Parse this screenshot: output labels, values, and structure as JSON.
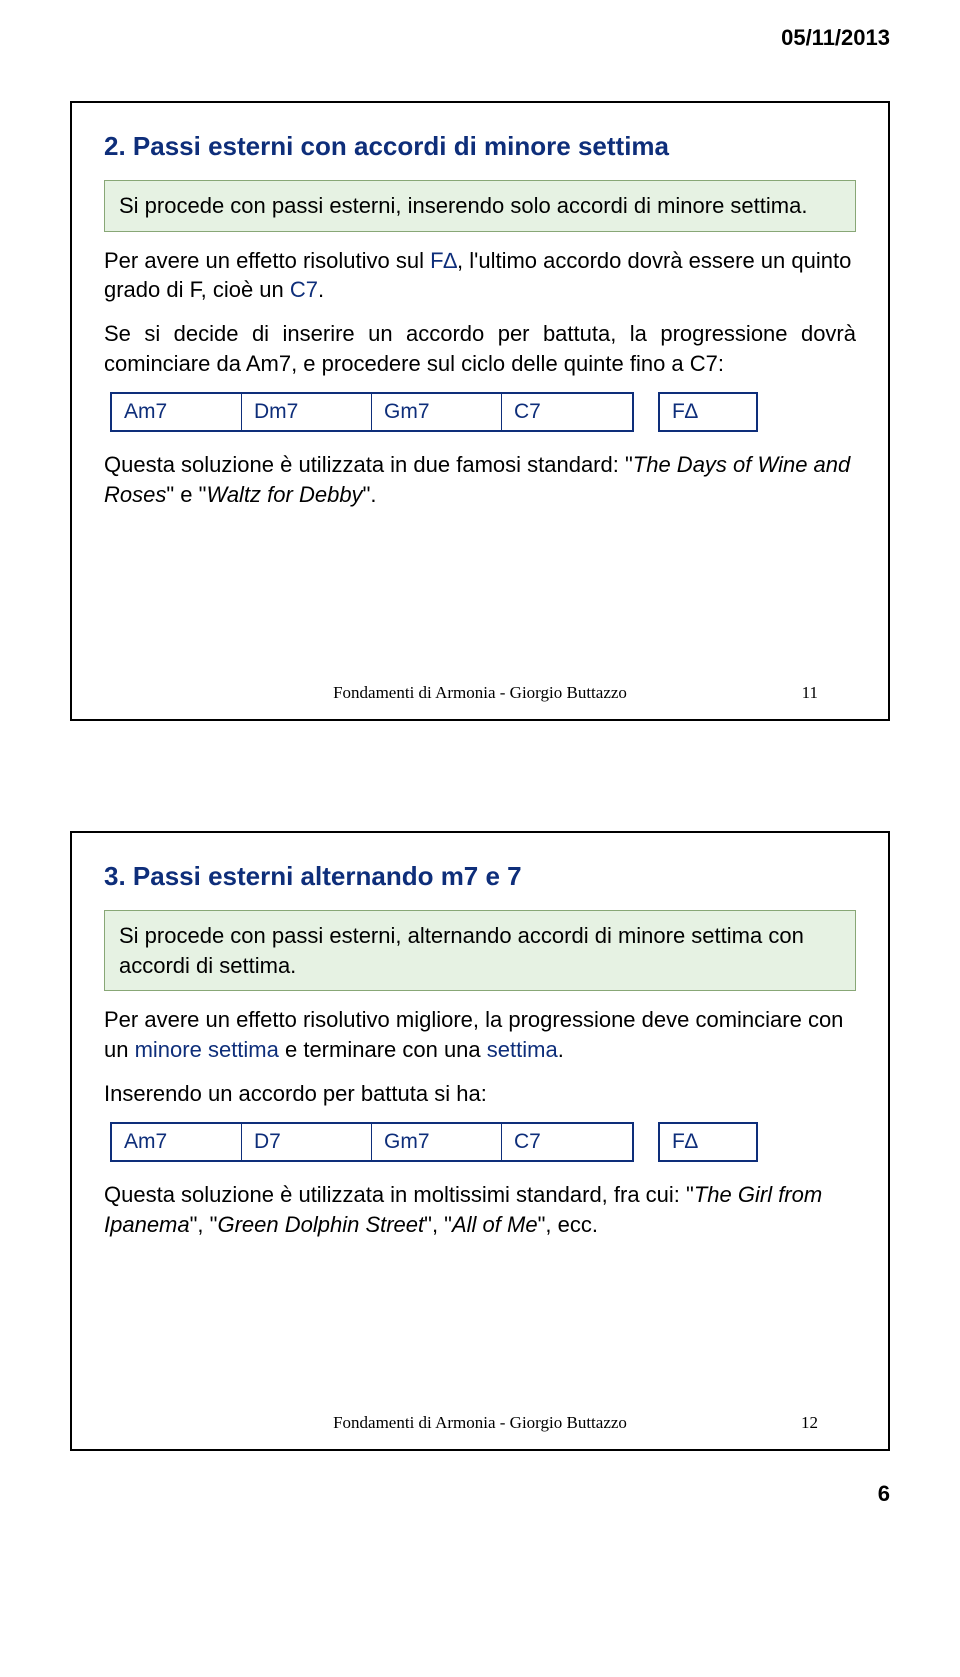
{
  "date": "05/11/2013",
  "page_number": "6",
  "slide1": {
    "title": "2. Passi esterni con accordi di minore settima",
    "callout": "Si procede con passi esterni, inserendo solo accordi di minore settima.",
    "p1_a": "Per avere un effetto risolutivo sul ",
    "p1_b": "F∆",
    "p1_c": ", l'ultimo accordo dovrà essere un quinto grado di F, cioè un ",
    "p1_d": "C7",
    "p1_e": ".",
    "p2": "Se si decide di inserire un accordo per battuta, la progressione dovrà cominciare da Am7, e procedere sul ciclo delle quinte fino a C7:",
    "chords_group": [
      "Am7",
      "Dm7",
      "Gm7",
      "C7"
    ],
    "chord_target": "F∆",
    "p3_a": "Questa soluzione è utilizzata in due famosi standard: \"",
    "p3_b": "The Days of Wine and Roses",
    "p3_c": "\" e \"",
    "p3_d": "Waltz for Debby",
    "p3_e": "\".",
    "footer": "Fondamenti di Armonia - Giorgio Buttazzo",
    "footer_num": "11"
  },
  "slide2": {
    "title": "3. Passi esterni alternando  m7  e  7",
    "callout": "Si procede con passi esterni, alternando accordi di minore settima con accordi di settima.",
    "p1_a": "Per avere un effetto risolutivo migliore, la progressione deve cominciare con un ",
    "p1_b": "minore settima",
    "p1_c": " e terminare con una ",
    "p1_d": "settima",
    "p1_e": ".",
    "p2": "Inserendo un accordo per battuta si ha:",
    "chords_group": [
      "Am7",
      "D7",
      "Gm7",
      "C7"
    ],
    "chord_target": "F∆",
    "p3_a": "Questa soluzione è utilizzata in moltissimi standard, fra cui: \"",
    "p3_b": "The Girl from Ipanema",
    "p3_c": "\", \"",
    "p3_d": "Green Dolphin Street",
    "p3_e": "\", \"",
    "p3_f": "All of Me",
    "p3_g": "\", ecc.",
    "footer": "Fondamenti di Armonia - Giorgio Buttazzo",
    "footer_num": "12"
  }
}
